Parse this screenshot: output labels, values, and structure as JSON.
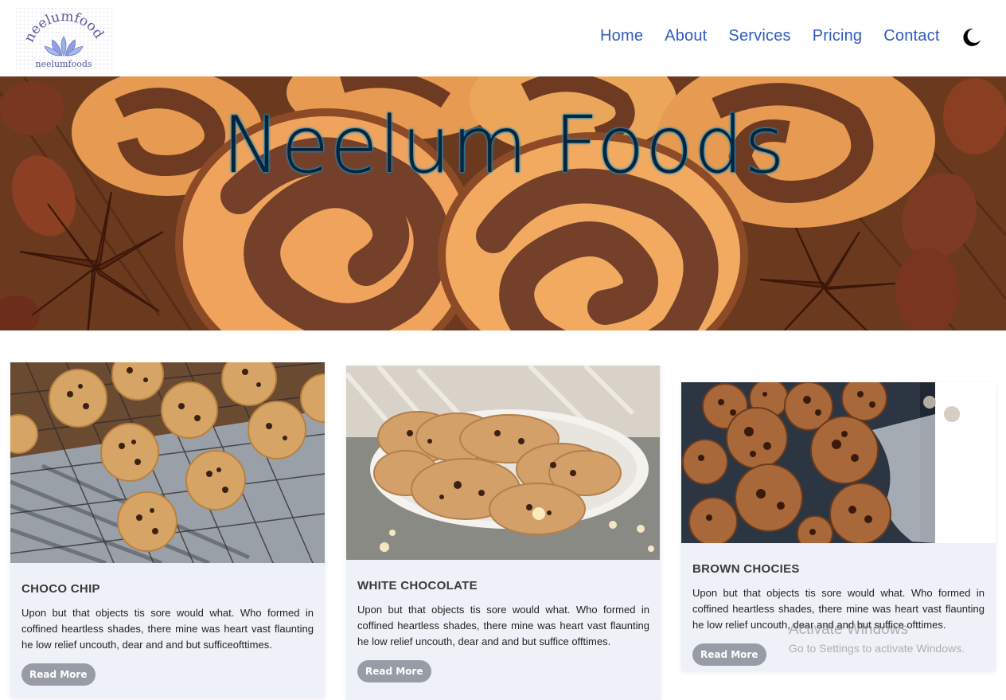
{
  "brand": {
    "logo_arc_text": "neelumfoods",
    "logo_caption": "neelumfoods"
  },
  "nav": {
    "items": [
      "Home",
      "About",
      "Services",
      "Pricing",
      "Contact"
    ],
    "theme_icon": "moon-icon"
  },
  "hero": {
    "title": "Neelum Foods"
  },
  "cards": [
    {
      "title": "CHOCO CHIP",
      "text": "Upon but that objects tis sore would what. Who formed in coffined heartless shades, there mine was heart vast flaunting he low relief uncouth, dear and and but sufficeofttimes.",
      "button": "Read More"
    },
    {
      "title": "WHITE CHOCOLATE",
      "text": "Upon but that objects tis sore would what. Who formed in coffined heartless shades, there mine was heart vast flaunting he low relief uncouth, dear and and but suffice offtimes.",
      "button": "Read More"
    },
    {
      "title": "BROWN CHOCIES",
      "text": "Upon but that objects tis sore would what. Who formed in coffined heartless shades, there mine was heart vast flaunting he low relief uncouth, dear and and but suffice ofttimes.",
      "button": "Read More"
    }
  ],
  "watermark": {
    "line1": "Activate Windows",
    "line2": "Go to Settings to activate Windows."
  },
  "colors": {
    "nav_link": "#2f5bbf",
    "card_bg": "#eef1f7",
    "button_bg": "#979ca6"
  }
}
